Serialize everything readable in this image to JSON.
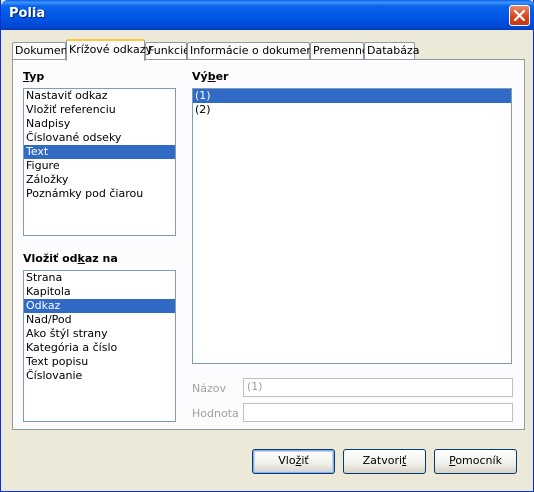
{
  "window": {
    "title": "Polia"
  },
  "tabs": [
    {
      "label": "Dokument",
      "active": false
    },
    {
      "label": "Krížové odkazy",
      "active": true
    },
    {
      "label": "Funkcie",
      "active": false
    },
    {
      "label": "Informácie o dokumente",
      "active": false
    },
    {
      "label": "Premenné",
      "active": false
    },
    {
      "label": "Databáza",
      "active": false
    }
  ],
  "type_section": {
    "label_pre": "",
    "label_key": "T",
    "label_post": "yp",
    "items": [
      "Nastaviť odkaz",
      "Vložiť referenciu",
      "Nadpisy",
      "Číslované odseky",
      "Text",
      "Figure",
      "Záložky",
      "Poznámky pod čiarou"
    ],
    "selected": "Text"
  },
  "insert_ref": {
    "label_pre": "Vložiť od",
    "label_key": "k",
    "label_post": "az na",
    "items": [
      "Strana",
      "Kapitola",
      "Odkaz",
      "Nad/Pod",
      "Ako štýl strany",
      "Kategória a číslo",
      "Text popisu",
      "Číslovanie"
    ],
    "selected": "Odkaz"
  },
  "selection": {
    "label_pre": "Vý",
    "label_key": "b",
    "label_post": "er",
    "items": [
      "(1)",
      "(2)"
    ],
    "selected": "(1)"
  },
  "name_field": {
    "label": "Názov",
    "value": "(1)"
  },
  "value_field": {
    "label": "Hodnota",
    "value": ""
  },
  "buttons": {
    "insert_pre": "Vlo",
    "insert_key": "ž",
    "insert_post": "iť",
    "close_pre": "Zatvori",
    "close_key": "ť",
    "close_post": "",
    "help_pre": "",
    "help_key": "P",
    "help_post": "omocník"
  },
  "colors": {
    "titlebar": "#0055e5",
    "selection": "#316ac5",
    "panel": "#fcfcfe",
    "dialog": "#ece9d8"
  }
}
